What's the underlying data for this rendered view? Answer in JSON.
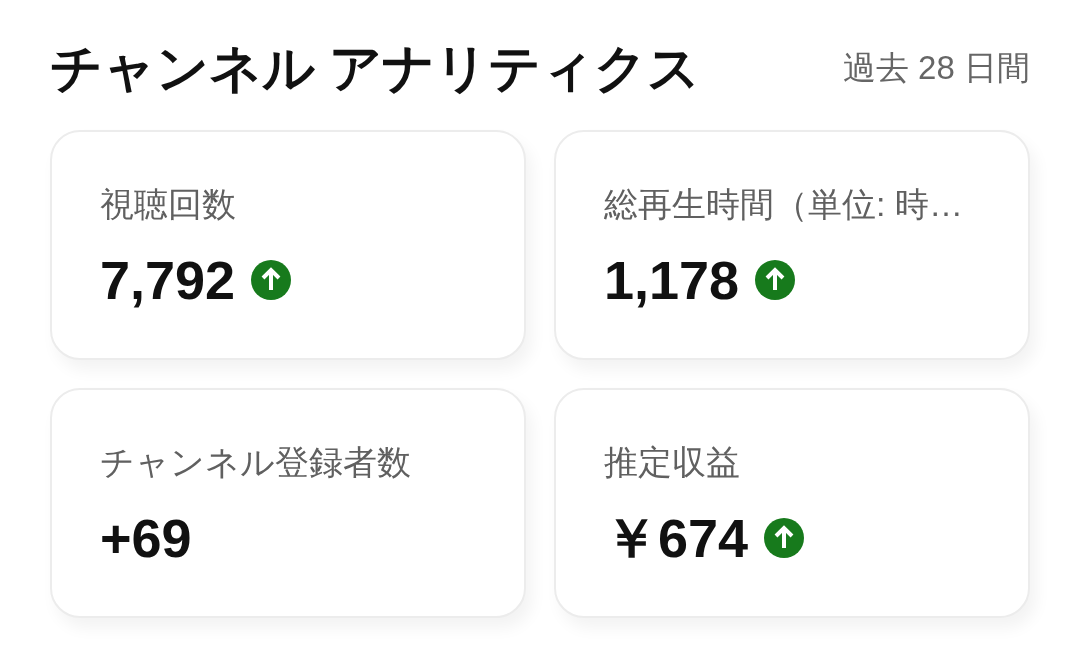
{
  "header": {
    "title": "チャンネル アナリティクス",
    "period": "過去 28 日間"
  },
  "cards": [
    {
      "label": "視聴回数",
      "value": "7,792",
      "trending_up": true
    },
    {
      "label": "総再生時間（単位: 時…",
      "value": "1,178",
      "trending_up": true
    },
    {
      "label": "チャンネル登録者数",
      "value": "+69",
      "trending_up": false
    },
    {
      "label": "推定収益",
      "value": "￥674",
      "trending_up": true
    }
  ]
}
